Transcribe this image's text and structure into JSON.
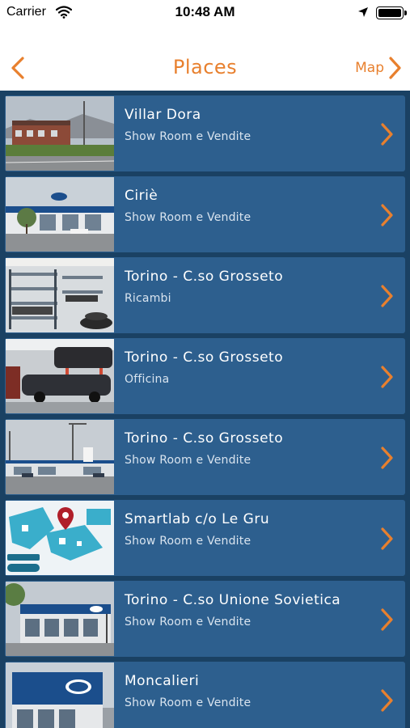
{
  "status": {
    "carrier": "Carrier",
    "time": "10:48 AM"
  },
  "nav": {
    "title": "Places",
    "map_label": "Map"
  },
  "colors": {
    "accent": "#e8802e",
    "list_background": "#1a4163",
    "row_background": "#2d5f8e"
  },
  "places": [
    {
      "title": "Villar Dora",
      "subtitle": "Show Room e Vendite",
      "thumbnail": "dealership-exterior-photo"
    },
    {
      "title": "Ciriè",
      "subtitle": "Show Room e Vendite",
      "thumbnail": "ford-showroom-photo"
    },
    {
      "title": "Torino - C.so Grosseto",
      "subtitle": "Ricambi",
      "thumbnail": "parts-warehouse-photo"
    },
    {
      "title": "Torino - C.so Grosseto",
      "subtitle": "Officina",
      "thumbnail": "workshop-photo"
    },
    {
      "title": "Torino - C.so Grosseto",
      "subtitle": "Show Room e Vendite",
      "thumbnail": "dealership-street-photo"
    },
    {
      "title": "Smartlab c/o Le Gru",
      "subtitle": "Show Room e Vendite",
      "thumbnail": "mall-map-image"
    },
    {
      "title": "Torino - C.so Unione Sovietica",
      "subtitle": "Show Room e Vendite",
      "thumbnail": "ford-building-photo"
    },
    {
      "title": "Moncalieri",
      "subtitle": "Show Room e Vendite",
      "thumbnail": "ford-store-photo"
    }
  ]
}
